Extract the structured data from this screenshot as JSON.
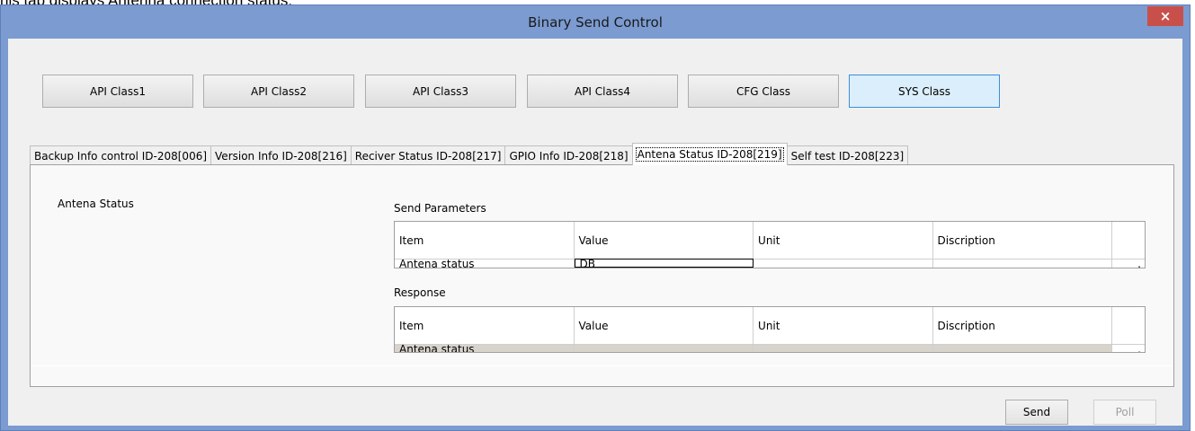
{
  "caption": "his tab displays Antenna connection status.",
  "window": {
    "title": "Binary Send Control",
    "close_glyph": "×"
  },
  "class_buttons": [
    "API Class1",
    "API Class2",
    "API Class3",
    "API Class4",
    "CFG Class",
    "SYS Class"
  ],
  "active_class": "SYS Class",
  "tabs": [
    "Backup Info control ID-208[006]",
    "Version Info ID-208[216]",
    "Reciver Status ID-208[217]",
    "GPIO Info ID-208[218]",
    "Antena Status ID-208[219]",
    "Self test ID-208[223]"
  ],
  "active_tab": "Antena Status ID-208[219]",
  "panel": {
    "heading": "Antena Status",
    "send_label": "Send Parameters",
    "response_label": "Response",
    "columns": [
      "Item",
      "Value",
      "Unit",
      "Discription"
    ],
    "send_row": [
      "Antena status",
      "DB",
      "",
      ""
    ],
    "response_row": [
      "Antena status",
      "",
      "",
      ""
    ],
    "row_marker": "."
  },
  "buttons": {
    "send": "Send",
    "poll": "Poll"
  },
  "colors": {
    "titlebar": "#7b9bd1",
    "close": "#c9504a",
    "active_class_button": "#dbeefc",
    "response_row": "#d8d4cc"
  }
}
